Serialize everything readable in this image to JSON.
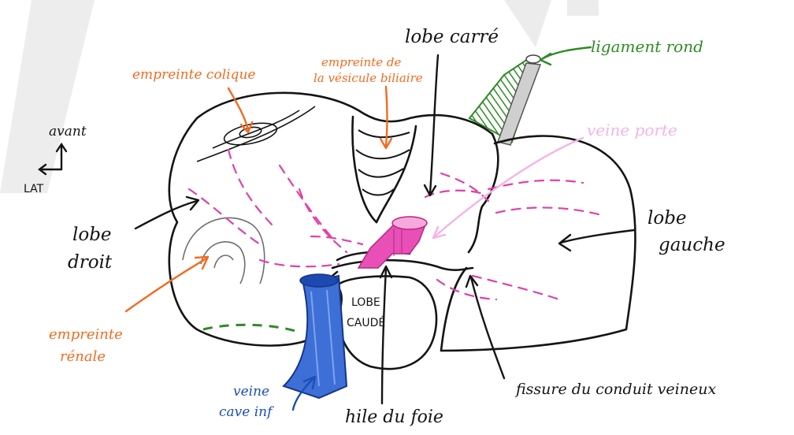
{
  "colors": {
    "ink": "#141414",
    "orange": "#f26b21",
    "green": "#2e8b24",
    "pink": "#e040a8",
    "pink_light": "#f3b4e8",
    "blue": "#1d4fb5",
    "grey": "#6e6e6e"
  },
  "labels": {
    "lobe_carre": "lobe carré",
    "ligament_rond": "ligament rond",
    "empreinte_colique": "empreinte colique",
    "empreinte_vesicule_l1": "empreinte de",
    "empreinte_vesicule_l2": "la vésicule biliaire",
    "veine_porte": "veine porte",
    "avant": "avant",
    "lat": "LAT",
    "lobe_droit_l1": "lobe",
    "lobe_droit_l2": "droit",
    "lobe_gauche_l1": "lobe",
    "lobe_gauche_l2": "gauche",
    "lobe_caude_l1": "LOBE",
    "lobe_caude_l2": "CAUDÉ",
    "empreinte_renale_l1": "empreinte",
    "empreinte_renale_l2": "rénale",
    "veine_cave_l1": "veine",
    "veine_cave_l2": "cave inf",
    "hile": "hile du foie",
    "fissure": "fissure du conduit veineux"
  }
}
